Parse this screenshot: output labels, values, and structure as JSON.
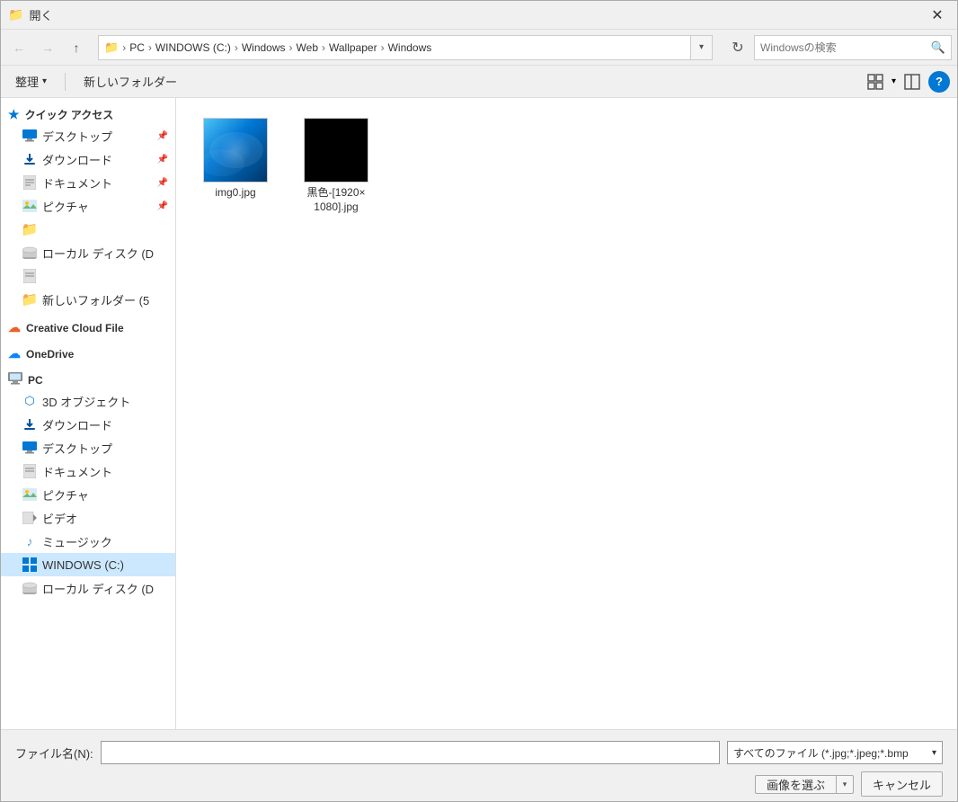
{
  "titlebar": {
    "title": "開く",
    "close_label": "✕"
  },
  "navbar": {
    "back_btn": "←",
    "forward_btn": "→",
    "up_btn": "↑",
    "folder_icon": "📁",
    "breadcrumbs": [
      {
        "label": "PC"
      },
      {
        "label": "WINDOWS (C:)"
      },
      {
        "label": "Windows"
      },
      {
        "label": "Web"
      },
      {
        "label": "Wallpaper"
      },
      {
        "label": "Windows"
      }
    ],
    "dropdown_icon": "▾",
    "refresh_icon": "↻",
    "search_placeholder": "Windowsの検索",
    "search_icon": "🔍"
  },
  "toolbar": {
    "organize_label": "整理",
    "organize_dropdown": "▾",
    "new_folder_label": "新しいフォルダー",
    "view_icon_grid": "⊞",
    "view_icon_pane": "▢",
    "help_icon": "?"
  },
  "sidebar": {
    "quick_access_label": "クイック アクセス",
    "items_quick": [
      {
        "label": "デスクトップ",
        "icon": "desktop",
        "pinned": true
      },
      {
        "label": "ダウンロード",
        "icon": "download",
        "pinned": true
      },
      {
        "label": "ドキュメント",
        "icon": "documents",
        "pinned": true
      },
      {
        "label": "ピクチャ",
        "icon": "pictures",
        "pinned": true
      },
      {
        "label": "",
        "icon": "folder-yellow",
        "pinned": false
      },
      {
        "label": "ローカル ディスク (D",
        "icon": "drive",
        "pinned": false
      },
      {
        "label": "",
        "icon": "documents-sm",
        "pinned": false
      },
      {
        "label": "新しいフォルダー (5",
        "icon": "folder-yellow",
        "pinned": false
      }
    ],
    "creative_cloud_label": "Creative Cloud File",
    "onedrive_label": "OneDrive",
    "pc_label": "PC",
    "items_pc": [
      {
        "label": "3D オブジェクト",
        "icon": "3d"
      },
      {
        "label": "ダウンロード",
        "icon": "download"
      },
      {
        "label": "デスクトップ",
        "icon": "desktop"
      },
      {
        "label": "ドキュメント",
        "icon": "documents"
      },
      {
        "label": "ピクチャ",
        "icon": "pictures"
      },
      {
        "label": "ビデオ",
        "icon": "video"
      },
      {
        "label": "ミュージック",
        "icon": "music"
      },
      {
        "label": "WINDOWS (C:)",
        "icon": "windows",
        "selected": true
      },
      {
        "label": "ローカル ディスク (D",
        "icon": "drive"
      }
    ]
  },
  "files": [
    {
      "name": "img0.jpg",
      "type": "windows_wallpaper"
    },
    {
      "name": "黒色-[1920×\n1080].jpg",
      "type": "black"
    }
  ],
  "bottom": {
    "filename_label": "ファイル名(N):",
    "filename_value": "",
    "filetype_label": "すべてのファイル (*.jpg;*.jpeg;*.bmp",
    "filetype_dropdown": "▾",
    "open_btn": "画像を選ぶ",
    "open_arrow": "▾",
    "cancel_btn": "キャンセル"
  }
}
